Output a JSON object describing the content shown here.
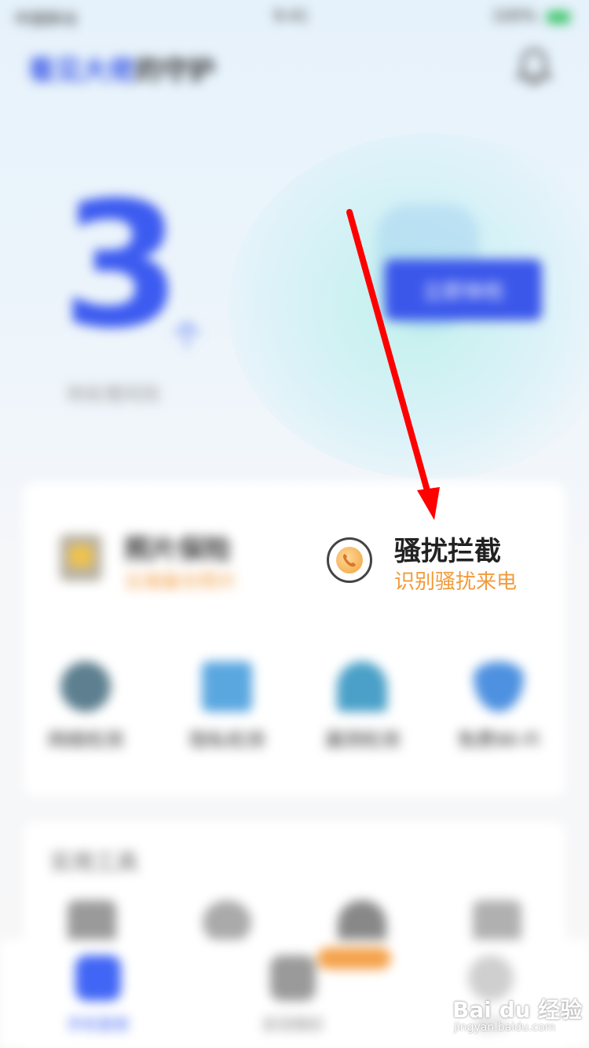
{
  "status_bar": {
    "carrier": "中国移动",
    "time": "9:41",
    "battery": "100%"
  },
  "header": {
    "name": "看见大佬",
    "greeting_rest": "的守护"
  },
  "hero": {
    "risk_count": "3",
    "unit": "个",
    "caption": "待处理风险",
    "scan_button": "立即体检"
  },
  "features": {
    "photo": {
      "title": "照片保险",
      "subtitle": "云端备份照片"
    },
    "harass": {
      "title": "骚扰拦截",
      "subtitle": "识别骚扰来电"
    },
    "grid": [
      {
        "label": "网络检测",
        "icon": "globe-icon",
        "color": "#5d7f8f"
      },
      {
        "label": "隐私检测",
        "icon": "screen-icon",
        "color": "#5aa7e0"
      },
      {
        "label": "漏洞检测",
        "icon": "dome-icon",
        "color": "#4aa0c8"
      },
      {
        "label": "免费Wi-Fi",
        "icon": "wifi-icon",
        "color": "#4e91e0"
      }
    ]
  },
  "tools": {
    "title": "实用工具"
  },
  "bottom_nav": [
    {
      "label": "手机管家",
      "icon": "home-icon",
      "active": true,
      "color": "#4166f5"
    },
    {
      "label": "发现精彩",
      "icon": "discover-icon",
      "active": false,
      "color": "#9a9a9a"
    },
    {
      "label": "我的",
      "icon": "profile-icon",
      "active": false,
      "color": "#cfcfcf"
    }
  ],
  "watermark": {
    "main": "Bai du 经验",
    "sub": "jingyan.baidu.com"
  },
  "colors": {
    "accent": "#3c5bf0",
    "highlight_orange": "#f19b3b",
    "annotation_arrow": "#ff0000"
  }
}
